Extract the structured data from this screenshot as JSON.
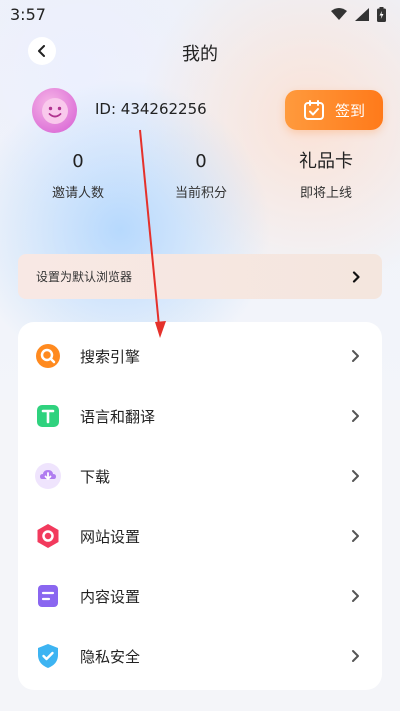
{
  "status_bar": {
    "time": "3:57"
  },
  "nav": {
    "title": "我的"
  },
  "profile": {
    "id_text": "ID: 434262256",
    "signin_label": "签到"
  },
  "stats": [
    {
      "value": "0",
      "label": "邀请人数"
    },
    {
      "value": "0",
      "label": "当前积分"
    },
    {
      "value": "礼品卡",
      "label": "即将上线"
    }
  ],
  "default_browser": {
    "label": "设置为默认浏览器"
  },
  "menu": [
    {
      "label": "搜索引擎",
      "icon": "search-engine-icon",
      "color": "#ff8a1f"
    },
    {
      "label": "语言和翻译",
      "icon": "translate-icon",
      "color": "#2fd27e"
    },
    {
      "label": "下载",
      "icon": "download-icon",
      "color": "#b07cf0"
    },
    {
      "label": "网站设置",
      "icon": "website-settings-icon",
      "color": "#f23a5d"
    },
    {
      "label": "内容设置",
      "icon": "content-settings-icon",
      "color": "#8a66f0"
    },
    {
      "label": "隐私安全",
      "icon": "privacy-shield-icon",
      "color": "#3db4f2"
    }
  ],
  "colors": {
    "accent": "#ff8a2a",
    "annotation_arrow": "#e5312b"
  }
}
